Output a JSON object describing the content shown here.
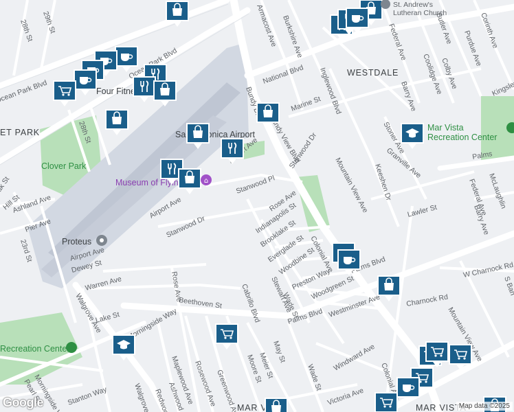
{
  "map": {
    "attribution": "Map data ©2025",
    "logo": "Google",
    "places": {
      "lutheran_church_line1": "St. Andrew's",
      "lutheran_church_line2": "Lutheran Church",
      "westdale": "WESTDALE",
      "mar_vista_recreation": "Mar Vista",
      "mar_vista_recreation_2": "Recreation Center",
      "museum": "Museum of Flying",
      "proteus": "Proteus",
      "clover_park": "Clover Park",
      "santa_monica_airport": "Santa Monica Airport",
      "recreation_center_left": "Recreation Center",
      "ocean_park_blvd": "Ocean Park Blvd",
      "fitness_label": "Four Fitness",
      "et_park": "ET PARK",
      "mar_vista_bottom": "MAR VISTA",
      "mar_vista_bottom_2": "MAR VISTA"
    },
    "streets": [
      "29th St",
      "28th St",
      "28th St",
      "Armacost Ave",
      "Burkshire Ave",
      "Federal Ave",
      "Butler Ave",
      "Purdue Ave",
      "Corinth Ave",
      "Colby Ave",
      "Coolidge Ave",
      "Barry Ave",
      "Kingsley",
      "National Blvd",
      "Inglewood Blvd",
      "Marine St",
      "Bundy Dr",
      "Bundy View Blvd",
      "Stoner Ave",
      "Stanwood Dr",
      "Mountain View Ave",
      "Keeshen Dr",
      "Granville Ave",
      "Palms",
      "McLaughlin",
      "Federal Ave",
      "Barry Ave",
      "Airport Ave",
      "Stanwood Pl",
      "Rose Ave",
      "Indianapolis St",
      "Brooklake St",
      "Everglade St",
      "Woodbine St",
      "Colonial Ave",
      "Palms Blvd",
      "Lawler St",
      "W Charnock Rd",
      "Charnock Rd",
      "S Ban",
      "Mountain View Ave",
      "Preston Way",
      "Woodgreen St",
      "Westminster Ave",
      "Stewart Ave",
      "Wade St",
      "Cabrillo Blvd",
      "Meier St",
      "May St",
      "Moore St",
      "Beethoven St",
      "Rose Ave",
      "Stanwood Dr",
      "Airport Ave",
      "Dewey St",
      "Warren Ave",
      "Walgrove Ave",
      "Lake St",
      "Morningside Way",
      "Maplewood Ave",
      "Rosewood Ave",
      "Ashwood Ave",
      "Greenwood Ave",
      "Redwood",
      "Walgrove Ave",
      "Windward Ave",
      "Victoria Ave",
      "Wade St",
      "Colonial Ave",
      "Ashland Ave",
      "Pier Ave",
      "Hill St",
      "23rd St",
      "Pearl St",
      "Morningside Way",
      "Palms Blvd",
      "Ocean Park Blvd",
      "Airport Ave",
      "Ocean Park Blvd",
      "ak St",
      "Stanton Way"
    ],
    "pins": {
      "shopping": "shopping-bag-icon",
      "restaurant": "restaurant-icon",
      "cafe": "cafe-icon",
      "grocery": "grocery-cart-icon",
      "school": "school-icon",
      "park": "park-icon",
      "museum": "museum-icon",
      "place": "place-icon"
    },
    "colors": {
      "background": "#eef0f3",
      "road": "#ffffff",
      "arterial": "#dde1e6",
      "airport": "#c9d0dc",
      "park": "#b8e0b9",
      "pin": "#1a5e8a",
      "museum_pin": "#a151c8",
      "poi_text_park": "#2e8f43",
      "poi_text_museum": "#8a3fb0"
    }
  }
}
